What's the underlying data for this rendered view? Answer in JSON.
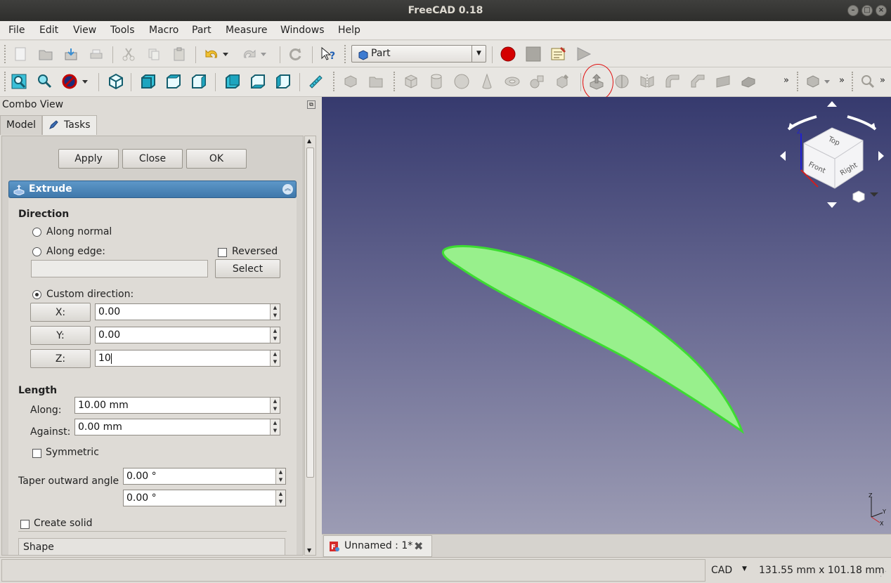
{
  "window": {
    "title": "FreeCAD 0.18"
  },
  "menu": [
    "File",
    "Edit",
    "View",
    "Tools",
    "Macro",
    "Part",
    "Measure",
    "Windows",
    "Help"
  ],
  "toolbar": {
    "workbench": "Part"
  },
  "combo": {
    "title": "Combo View",
    "tabs": [
      "Model",
      "Tasks"
    ],
    "active_tab": "Tasks"
  },
  "task": {
    "buttons": {
      "apply": "Apply",
      "close": "Close",
      "ok": "OK"
    },
    "panel_title": "Extrude",
    "direction": {
      "heading": "Direction",
      "along_normal": "Along normal",
      "along_edge": "Along edge:",
      "reversed": "Reversed",
      "edge_value": "",
      "select": "Select",
      "custom": "Custom direction:",
      "selected": "custom",
      "x_label": "X:",
      "x_value": "0.00",
      "y_label": "Y:",
      "y_value": "0.00",
      "z_label": "Z:",
      "z_value": "10"
    },
    "length": {
      "heading": "Length",
      "along_label": "Along:",
      "along_value": "10.00 mm",
      "against_label": "Against:",
      "against_value": "0.00 mm",
      "symmetric": "Symmetric"
    },
    "taper": {
      "label": "Taper outward angle",
      "value1": "0.00 °",
      "value2": "0.00 °"
    },
    "create_solid": "Create solid",
    "shape_section": "Shape"
  },
  "navcube": {
    "faces": [
      "Top",
      "Front",
      "Right"
    ]
  },
  "document_tab": {
    "label": "Unnamed : 1*"
  },
  "status": {
    "nav_style": "CAD",
    "dimensions": "131.55 mm x 101.18 mm"
  },
  "colors": {
    "accent_highlight": "#e01010",
    "shape_fill": "#98f08c",
    "shape_edge": "#3ddc32",
    "panel_header": "#4c86b8"
  }
}
